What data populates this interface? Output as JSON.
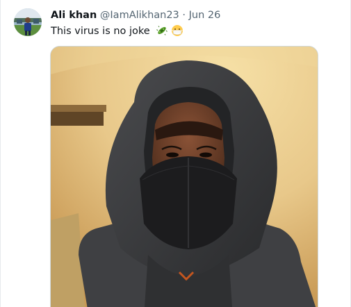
{
  "tweet": {
    "author_name": "Ali khan",
    "handle": "@IamAlikhan23",
    "separator": "·",
    "date": "Jun 26",
    "text": "This virus is no joke",
    "emojis": [
      "microbe-emoji",
      "face-with-medical-mask-emoji"
    ]
  },
  "colors": {
    "name": "#0f1419",
    "meta": "#536471",
    "wall": "#e8c88a",
    "hoodie": "#3a3b3d",
    "mask": "#1c1c1e"
  }
}
